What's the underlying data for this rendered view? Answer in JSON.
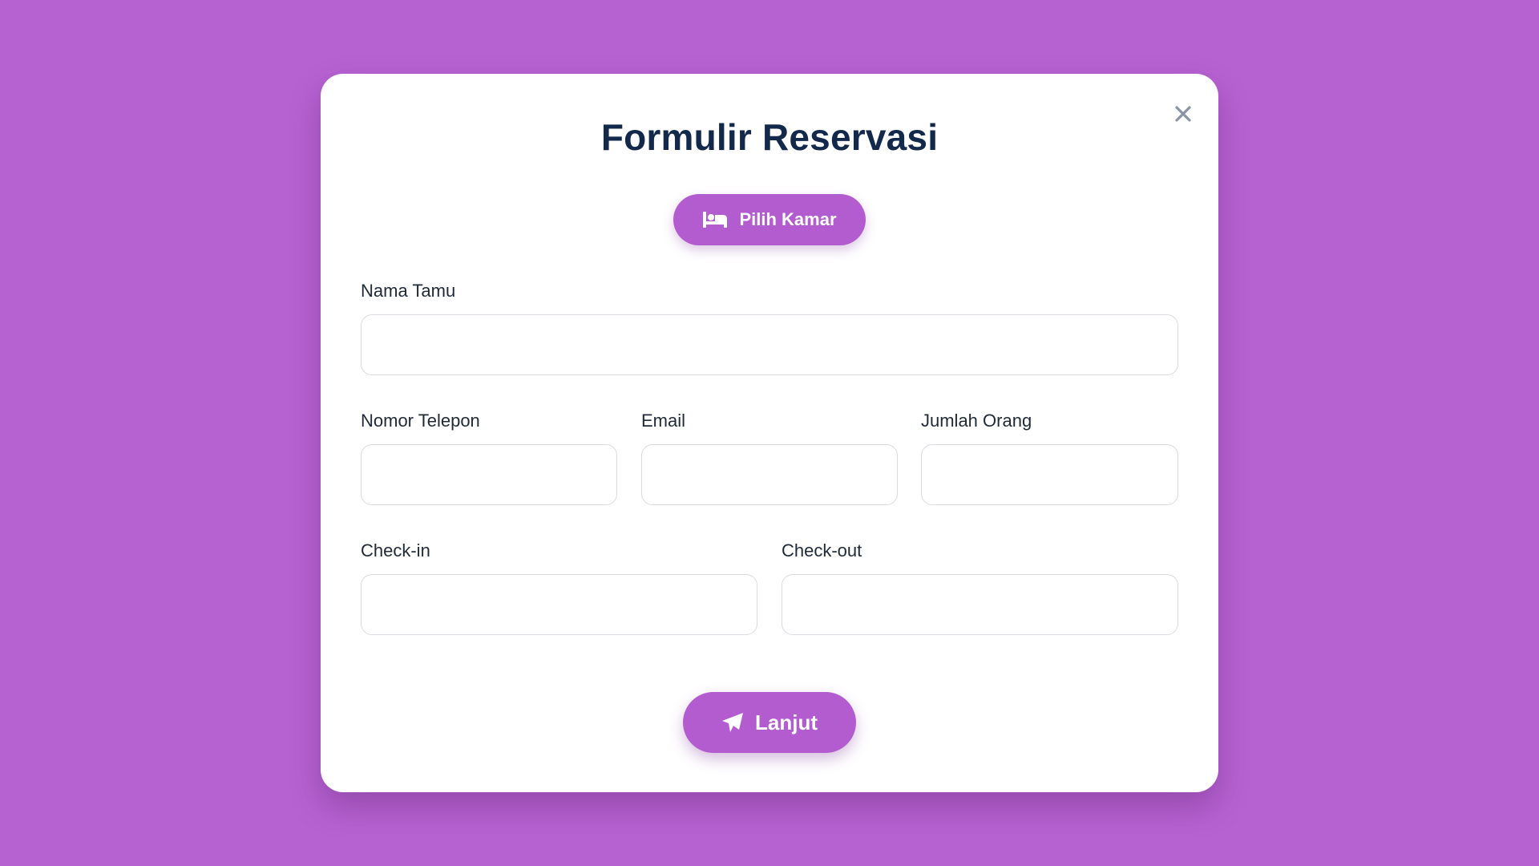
{
  "modal": {
    "title": "Formulir Reservasi",
    "close_icon": "close-icon"
  },
  "room_button": {
    "label": "Pilih Kamar",
    "icon": "bed-icon"
  },
  "fields": {
    "guest_name": {
      "label": "Nama Tamu",
      "value": ""
    },
    "phone": {
      "label": "Nomor Telepon",
      "value": ""
    },
    "email": {
      "label": "Email",
      "value": ""
    },
    "guests": {
      "label": "Jumlah Orang",
      "value": ""
    },
    "checkin": {
      "label": "Check-in",
      "value": ""
    },
    "checkout": {
      "label": "Check-out",
      "value": ""
    }
  },
  "next_button": {
    "label": "Lanjut",
    "icon": "paper-plane-icon"
  },
  "colors": {
    "background": "#b762d1",
    "accent": "#b35ccf",
    "title": "#13294b"
  }
}
